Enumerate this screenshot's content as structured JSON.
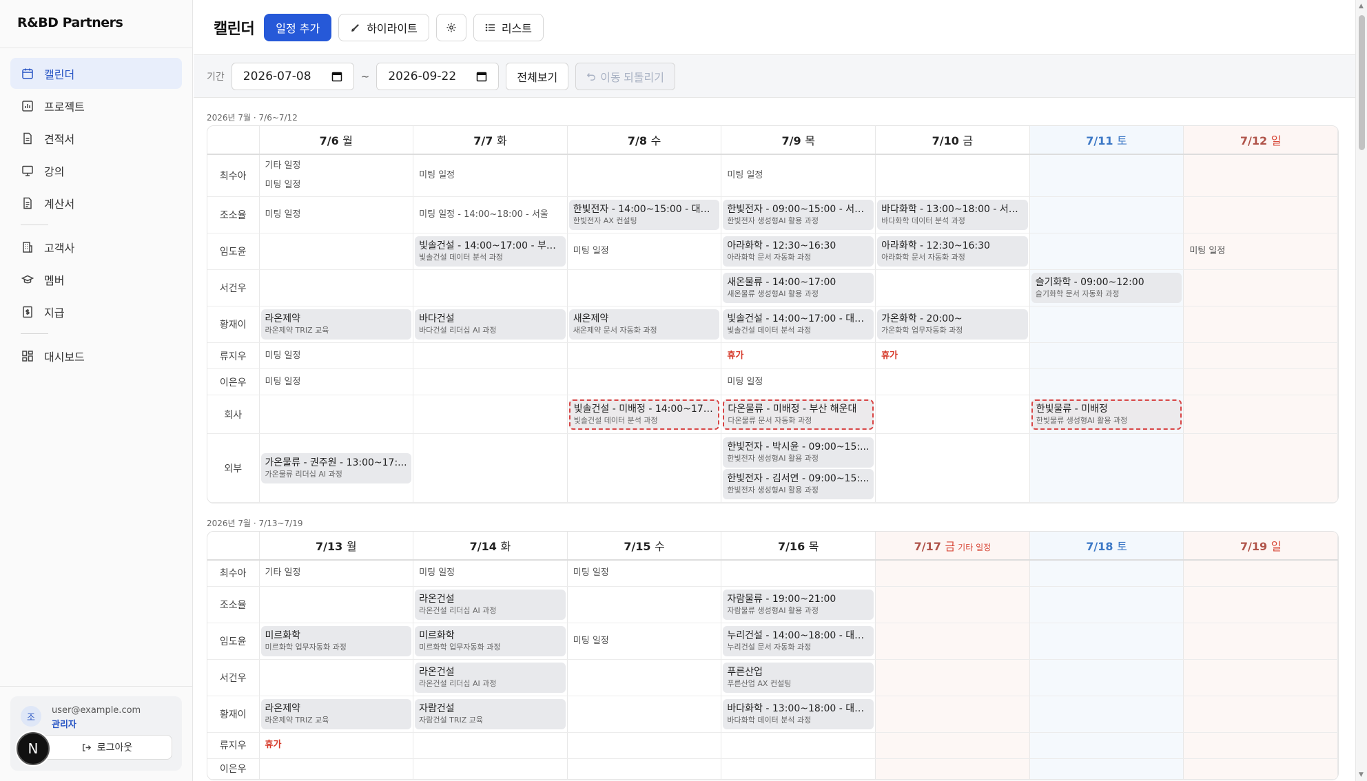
{
  "brand": "R&BD Partners",
  "nav": [
    {
      "label": "캘린더",
      "icon": "calendar-icon",
      "active": true
    },
    {
      "label": "프로젝트",
      "icon": "chart-icon"
    },
    {
      "label": "견적서",
      "icon": "document-icon"
    },
    {
      "label": "강의",
      "icon": "presentation-icon"
    },
    {
      "label": "계산서",
      "icon": "receipt-icon"
    },
    {
      "sep": true
    },
    {
      "label": "고객사",
      "icon": "building-icon"
    },
    {
      "label": "멤버",
      "icon": "graduation-cap-icon"
    },
    {
      "label": "지급",
      "icon": "payment-icon"
    },
    {
      "sep": true
    },
    {
      "label": "대시보드",
      "icon": "dashboard-icon"
    }
  ],
  "user": {
    "avatar": "조",
    "email": "user@example.com",
    "role": "관리자",
    "logout": "로그아웃",
    "badge": "N"
  },
  "header": {
    "title": "캘린더",
    "add": "일정 추가",
    "highlight": "하이라이트",
    "list": "리스트"
  },
  "filter": {
    "label": "기간",
    "from": "2026-07-08",
    "to": "2026-09-22",
    "tilde": "~",
    "all": "전체보기",
    "undo": "이동 되돌리기"
  },
  "weeks": [
    {
      "title": "2026년 7월 · 7/6~7/12",
      "days": [
        {
          "d": "7/6",
          "w": "월"
        },
        {
          "d": "7/7",
          "w": "화"
        },
        {
          "d": "7/8",
          "w": "수"
        },
        {
          "d": "7/9",
          "w": "목"
        },
        {
          "d": "7/10",
          "w": "금"
        },
        {
          "d": "7/11",
          "w": "토",
          "k": "sat"
        },
        {
          "d": "7/12",
          "w": "일",
          "k": "sun"
        }
      ],
      "rows": [
        {
          "name": "최수아",
          "cells": [
            [
              {
                "p": "기타 일정"
              },
              {
                "p": "미팅 일정"
              }
            ],
            [
              {
                "p": "미팅 일정"
              }
            ],
            [],
            [
              {
                "p": "미팅 일정"
              }
            ],
            [],
            [],
            []
          ]
        },
        {
          "name": "조소율",
          "cells": [
            [
              {
                "p": "미팅 일정"
              }
            ],
            [
              {
                "p": "미팅 일정 - 14:00~18:00 - 서울"
              }
            ],
            [
              {
                "t": "한빛전자 - 14:00~15:00 - 대구...",
                "s": "한빛전자 AX 컨설팅"
              }
            ],
            [
              {
                "t": "한빛전자 - 09:00~15:00 - 서울...",
                "s": "한빛전자 생성형AI 활용 과정"
              }
            ],
            [
              {
                "t": "바다화학 - 13:00~18:00 - 서울...",
                "s": "바다화학 데이터 분석 과정"
              }
            ],
            [],
            []
          ]
        },
        {
          "name": "임도윤",
          "cells": [
            [],
            [
              {
                "t": "빛솔건설 - 14:00~17:00 - 부산...",
                "s": "빛솔건설 데이터 분석 과정"
              }
            ],
            [
              {
                "p": "미팅 일정"
              }
            ],
            [
              {
                "t": "아라화학 - 12:30~16:30",
                "s": "아라화학 문서 자동화 과정"
              }
            ],
            [
              {
                "t": "아라화학 - 12:30~16:30",
                "s": "아라화학 문서 자동화 과정"
              }
            ],
            [],
            [
              {
                "p": "미팅 일정"
              }
            ]
          ]
        },
        {
          "name": "서건우",
          "cells": [
            [],
            [],
            [],
            [
              {
                "t": "새온물류 - 14:00~17:00",
                "s": "새온물류 생성형AI 활용 과정"
              }
            ],
            [],
            [
              {
                "t": "슬기화학 - 09:00~12:00",
                "s": "슬기화학 문서 자동화 과정"
              }
            ],
            []
          ]
        },
        {
          "name": "황재이",
          "cells": [
            [
              {
                "t": "라온제약",
                "s": "라온제약 TRIZ 교육"
              }
            ],
            [
              {
                "t": "바다건설",
                "s": "바다건설 리더십 AI 과정"
              }
            ],
            [
              {
                "t": "새온제약",
                "s": "새온제약 문서 자동화 과정"
              }
            ],
            [
              {
                "t": "빛솔건설 - 14:00~17:00 - 대구...",
                "s": "빛솔건설 데이터 분석 과정"
              }
            ],
            [
              {
                "t": "가온화학 - 20:00~",
                "s": "가온화학 업무자동화 과정"
              }
            ],
            [],
            []
          ]
        },
        {
          "name": "류지우",
          "cells": [
            [
              {
                "p": "미팅 일정"
              }
            ],
            [],
            [],
            [
              {
                "p": "휴가",
                "red": true
              }
            ],
            [
              {
                "p": "휴가",
                "red": true
              }
            ],
            [],
            []
          ]
        },
        {
          "name": "이은우",
          "cells": [
            [
              {
                "p": "미팅 일정"
              }
            ],
            [],
            [],
            [
              {
                "p": "미팅 일정"
              }
            ],
            [],
            [],
            []
          ]
        },
        {
          "name": "회사",
          "cells": [
            [],
            [],
            [
              {
                "t": "빛솔건설 - 미배정 - 14:00~17:...",
                "s": "빛솔건설 데이터 분석 과정",
                "dash": true
              }
            ],
            [
              {
                "t": "다온물류 - 미배정 - 부산 해운대",
                "s": "다온물류 문서 자동화 과정",
                "dash": true
              }
            ],
            [],
            [
              {
                "t": "한빛물류 - 미배정",
                "s": "한빛물류 생성형AI 활용 과정",
                "dash": true
              }
            ],
            []
          ]
        },
        {
          "name": "외부",
          "cells": [
            [
              {
                "t": "가온물류 - 권주원 - 13:00~17:...",
                "s": "가온물류 리더십 AI 과정"
              }
            ],
            [],
            [],
            [
              {
                "t": "한빛전자 - 박시윤 - 09:00~15:...",
                "s": "한빛전자 생성형AI 활용 과정"
              },
              {
                "t": "한빛전자 - 김서연 - 09:00~15:...",
                "s": "한빛전자 생성형AI 활용 과정"
              }
            ],
            [],
            [],
            []
          ]
        }
      ]
    },
    {
      "title": "2026년 7월 · 7/13~7/19",
      "days": [
        {
          "d": "7/13",
          "w": "월"
        },
        {
          "d": "7/14",
          "w": "화"
        },
        {
          "d": "7/15",
          "w": "수"
        },
        {
          "d": "7/16",
          "w": "목"
        },
        {
          "d": "7/17",
          "w": "금",
          "k": "hol",
          "extra": "기타 일정"
        },
        {
          "d": "7/18",
          "w": "토",
          "k": "sat"
        },
        {
          "d": "7/19",
          "w": "일",
          "k": "sun"
        }
      ],
      "rows": [
        {
          "name": "최수아",
          "cells": [
            [
              {
                "p": "기타 일정"
              }
            ],
            [
              {
                "p": "미팅 일정"
              }
            ],
            [
              {
                "p": "미팅 일정"
              }
            ],
            [],
            [],
            [],
            []
          ]
        },
        {
          "name": "조소율",
          "cells": [
            [],
            [
              {
                "t": "라온건설",
                "s": "라온건설 리더십 AI 과정"
              }
            ],
            [],
            [
              {
                "t": "자람물류 - 19:00~21:00",
                "s": "자람물류 생성형AI 활용 과정"
              }
            ],
            [],
            [],
            []
          ]
        },
        {
          "name": "임도윤",
          "cells": [
            [
              {
                "t": "미르화학",
                "s": "미르화학 업무자동화 과정"
              }
            ],
            [
              {
                "t": "미르화학",
                "s": "미르화학 업무자동화 과정"
              }
            ],
            [
              {
                "p": "미팅 일정"
              }
            ],
            [
              {
                "t": "누리건설 - 14:00~18:00 - 대전...",
                "s": "누리건설 문서 자동화 과정"
              }
            ],
            [],
            [],
            []
          ]
        },
        {
          "name": "서건우",
          "cells": [
            [],
            [
              {
                "t": "라온건설",
                "s": "라온건설 리더십 AI 과정"
              }
            ],
            [],
            [
              {
                "t": "푸른산업",
                "s": "푸른산업 AX 컨설팅"
              }
            ],
            [],
            [],
            []
          ]
        },
        {
          "name": "황재이",
          "cells": [
            [
              {
                "t": "라온제약",
                "s": "라온제약 TRIZ 교육"
              }
            ],
            [
              {
                "t": "자람건설",
                "s": "자람건설 TRIZ 교육"
              }
            ],
            [],
            [
              {
                "t": "바다화학 - 13:00~18:00 - 대전...",
                "s": "바다화학 데이터 분석 과정"
              }
            ],
            [],
            [],
            []
          ]
        },
        {
          "name": "류지우",
          "cells": [
            [
              {
                "p": "휴가",
                "red": true
              }
            ],
            [],
            [],
            [],
            [],
            [],
            []
          ]
        },
        {
          "name": "이은우",
          "cells": [
            [],
            [],
            [],
            [],
            [],
            [],
            []
          ]
        }
      ]
    }
  ]
}
